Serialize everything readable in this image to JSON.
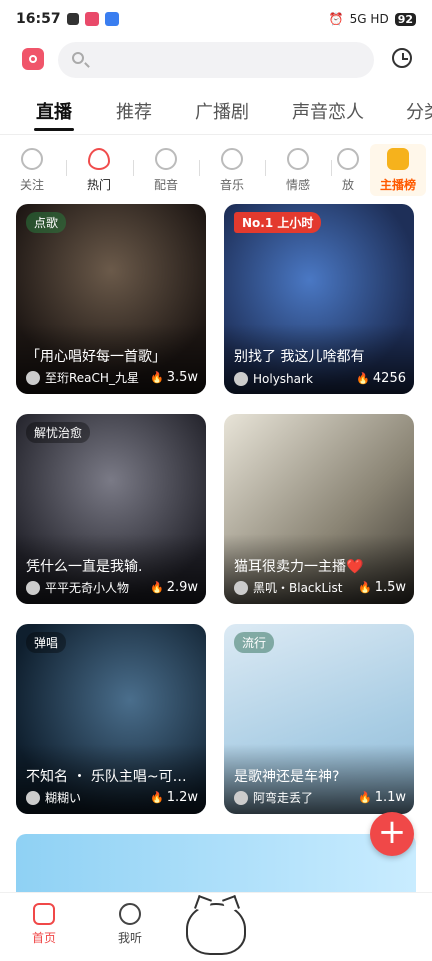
{
  "status_bar": {
    "time": "16:57",
    "signal": "5G HD",
    "battery": "92"
  },
  "tabs": [
    {
      "label": "直播",
      "active": true
    },
    {
      "label": "推荐"
    },
    {
      "label": "广播剧"
    },
    {
      "label": "声音恋人"
    },
    {
      "label": "分类"
    }
  ],
  "categories": [
    {
      "label": "关注",
      "icon": "person-icon"
    },
    {
      "label": "热门",
      "icon": "fire-icon"
    },
    {
      "label": "配音",
      "icon": "microphone-icon"
    },
    {
      "label": "音乐",
      "icon": "music-disc-icon"
    },
    {
      "label": "情感",
      "icon": "heart-icon"
    },
    {
      "label": "放",
      "icon": "star-icon"
    },
    {
      "label": "主播榜",
      "icon": "thumbs-up-icon"
    }
  ],
  "cards": [
    {
      "tag": "点歌",
      "title": "「用心唱好每一首歌」",
      "host": "至珩ReaCH_九星",
      "count": "3.5w",
      "bg": "#2b2320"
    },
    {
      "tag": "No.1 上小时",
      "title": "别找了 我这儿啥都有",
      "host": "Holyshark",
      "count": "4256",
      "bg": "#2d4c84"
    },
    {
      "tag": "解忧治愈",
      "title": "凭什么一直是我输.",
      "host": "平平无奇小人物",
      "count": "2.9w",
      "bg": "#3a3a44"
    },
    {
      "tag": "",
      "title": "猫耳很卖力一主播❤️",
      "host": "黑叽・BlackList",
      "count": "1.5w",
      "bg": "#7a7468"
    },
    {
      "tag": "弹唱",
      "title": "不知名 ・ 乐队主唱~可…",
      "host": "糊糊い",
      "count": "1.2w",
      "bg": "#1d3a52"
    },
    {
      "tag": "流行",
      "title": "是歌神还是车神?",
      "host": "阿弯走丢了",
      "count": "1.1w",
      "bg": "#b9d8ec"
    }
  ],
  "bottom_nav": [
    {
      "label": "首页",
      "active": true
    },
    {
      "label": "我听"
    }
  ],
  "fab": "+"
}
